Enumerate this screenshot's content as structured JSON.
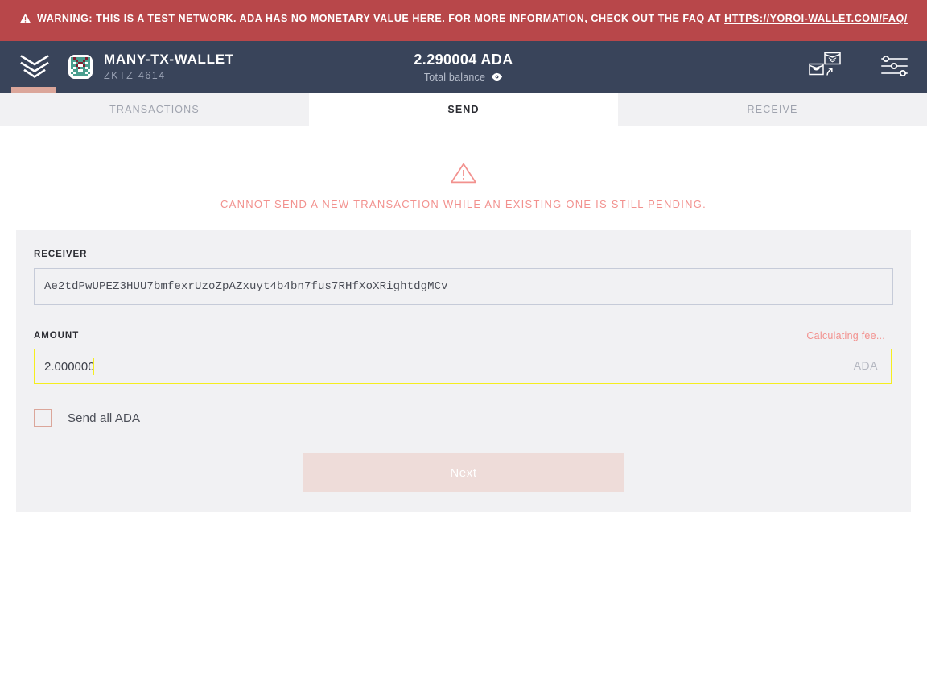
{
  "banner": {
    "icon": "warning-triangle-icon",
    "text": "WARNING: THIS IS A TEST NETWORK. ADA HAS NO MONETARY VALUE HERE. FOR MORE INFORMATION, CHECK OUT THE FAQ AT ",
    "link_text": "HTTPS://YOROI-WALLET.COM/FAQ/",
    "background_color": "#b8474a"
  },
  "topbar": {
    "logo_icon": "yoroi-chevron-logo-icon",
    "avatar_icon": "wallet-identicon-avatar",
    "wallet_name": "MANY-TX-WALLET",
    "wallet_plate": "ZKTZ-4614",
    "balance_amount": "2.290004 ADA",
    "balance_label": "Total balance",
    "balance_eye_icon": "eye-icon",
    "switch_wallet_icon": "switch-wallet-icon",
    "settings_icon": "settings-sliders-icon",
    "background_color": "#39445a",
    "accent_color": "#dba69a"
  },
  "tabs": [
    {
      "label": "TRANSACTIONS",
      "active": false
    },
    {
      "label": "SEND",
      "active": true
    },
    {
      "label": "RECEIVE",
      "active": false
    }
  ],
  "pending_notice": {
    "icon": "warning-triangle-icon",
    "text": "CANNOT SEND A NEW TRANSACTION WHILE AN EXISTING ONE IS STILL PENDING.",
    "color": "#f2918e"
  },
  "send_form": {
    "receiver": {
      "label": "RECEIVER",
      "value": "Ae2tdPwUPEZ3HUU7bmfexrUzoZpAZxuyt4b4bn7fus7RHfXoXRightdgMCv",
      "placeholder": "Receiver"
    },
    "amount": {
      "label": "AMOUNT",
      "value": "2.000000",
      "placeholder": "0.000000",
      "unit": "ADA",
      "focus_border_color": "#f5ee1e",
      "fee_status": "Calculating fee..."
    },
    "send_all": {
      "label": "Send all ADA",
      "checked": false
    },
    "submit": {
      "label": "Next",
      "disabled": true,
      "background_color": "#eedcd9"
    }
  }
}
